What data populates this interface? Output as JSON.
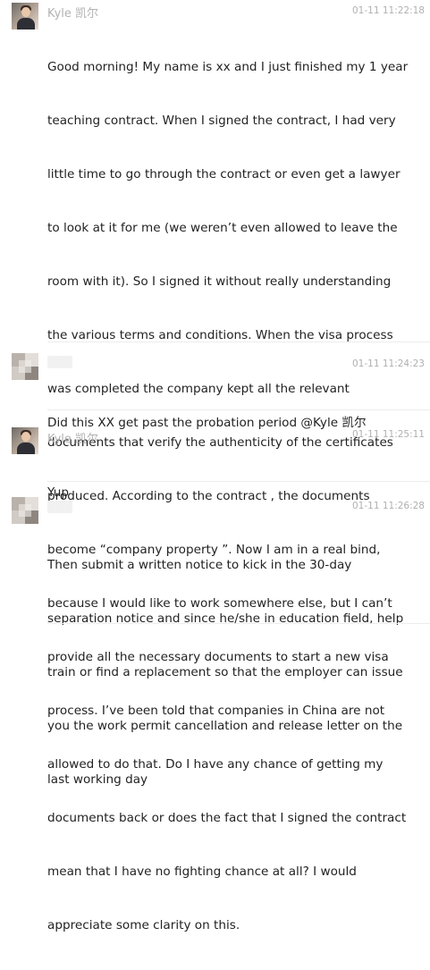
{
  "messages": [
    {
      "sender": "Kyle 凯尔",
      "time": "01-11 11:22:18",
      "avatar": "kyle-avatar-photo",
      "lines": [
        "Good morning! My name is xx and I just finished my 1 year",
        "teaching contract. When I signed the contract, I had very",
        "little time to go through the contract or even get a lawyer",
        "to look at it for me (we weren’t even allowed to leave the",
        "room with it). So I signed it without really understanding",
        "the various terms and conditions. When the visa process",
        "was completed the company kept all the relevant",
        "documents that verify the authenticity of the certificates",
        "produced. According to the contract , the documents",
        "become “company property ”. Now I am in a real bind,",
        "because I would like to work somewhere else, but I can’t",
        "provide all the necessary documents to start a new visa",
        "process. I’ve been told that companies in China are not",
        "allowed to do that. Do I have any chance of getting my",
        "documents back or does the fact that I signed the contract",
        "mean that I have no fighting chance at all? I would",
        "appreciate some clarity on this."
      ]
    },
    {
      "sender": "",
      "time": "01-11 11:24:23",
      "avatar": "blurred-avatar",
      "lines": [
        "Did this XX get past the probation period @Kyle 凯尔"
      ]
    },
    {
      "sender": "Kyle 凯尔",
      "time": "01-11 11:25:11",
      "avatar": "kyle-avatar-photo",
      "lines": [
        "Yup"
      ]
    },
    {
      "sender": "",
      "time": "01-11 11:26:28",
      "avatar": "blurred-avatar",
      "lines": [
        "Then submit a written notice to kick in the 30-day",
        "separation notice and since he/she in education field, help",
        "train or find a replacement so that the employer can issue",
        "you the work permit cancellation and release letter on the",
        "last working day"
      ]
    }
  ]
}
